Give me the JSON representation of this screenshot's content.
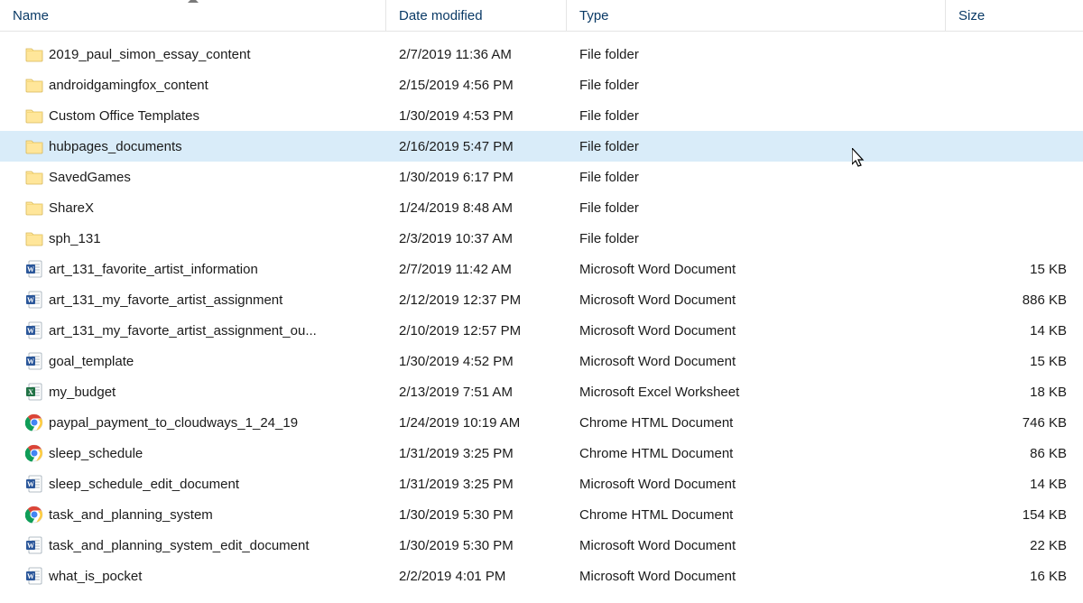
{
  "columns": {
    "name": "Name",
    "date": "Date modified",
    "type": "Type",
    "size": "Size"
  },
  "hover_index": 3,
  "items": [
    {
      "icon": "folder",
      "name": "2019_paul_simon_essay_content",
      "date": "2/7/2019 11:36 AM",
      "type": "File folder",
      "size": ""
    },
    {
      "icon": "folder",
      "name": "androidgamingfox_content",
      "date": "2/15/2019 4:56 PM",
      "type": "File folder",
      "size": ""
    },
    {
      "icon": "folder",
      "name": "Custom Office Templates",
      "date": "1/30/2019 4:53 PM",
      "type": "File folder",
      "size": ""
    },
    {
      "icon": "folder",
      "name": "hubpages_documents",
      "date": "2/16/2019 5:47 PM",
      "type": "File folder",
      "size": ""
    },
    {
      "icon": "folder",
      "name": "SavedGames",
      "date": "1/30/2019 6:17 PM",
      "type": "File folder",
      "size": ""
    },
    {
      "icon": "folder",
      "name": "ShareX",
      "date": "1/24/2019 8:48 AM",
      "type": "File folder",
      "size": ""
    },
    {
      "icon": "folder",
      "name": "sph_131",
      "date": "2/3/2019 10:37 AM",
      "type": "File folder",
      "size": ""
    },
    {
      "icon": "word",
      "name": "art_131_favorite_artist_information",
      "date": "2/7/2019 11:42 AM",
      "type": "Microsoft Word Document",
      "size": "15 KB"
    },
    {
      "icon": "word",
      "name": "art_131_my_favorte_artist_assignment",
      "date": "2/12/2019 12:37 PM",
      "type": "Microsoft Word Document",
      "size": "886 KB"
    },
    {
      "icon": "word",
      "name": "art_131_my_favorte_artist_assignment_ou...",
      "date": "2/10/2019 12:57 PM",
      "type": "Microsoft Word Document",
      "size": "14 KB"
    },
    {
      "icon": "word",
      "name": "goal_template",
      "date": "1/30/2019 4:52 PM",
      "type": "Microsoft Word Document",
      "size": "15 KB"
    },
    {
      "icon": "excel",
      "name": "my_budget",
      "date": "2/13/2019 7:51 AM",
      "type": "Microsoft Excel Worksheet",
      "size": "18 KB"
    },
    {
      "icon": "chrome",
      "name": "paypal_payment_to_cloudways_1_24_19",
      "date": "1/24/2019 10:19 AM",
      "type": "Chrome HTML Document",
      "size": "746 KB"
    },
    {
      "icon": "chrome",
      "name": "sleep_schedule",
      "date": "1/31/2019 3:25 PM",
      "type": "Chrome HTML Document",
      "size": "86 KB"
    },
    {
      "icon": "word",
      "name": "sleep_schedule_edit_document",
      "date": "1/31/2019 3:25 PM",
      "type": "Microsoft Word Document",
      "size": "14 KB"
    },
    {
      "icon": "chrome",
      "name": "task_and_planning_system",
      "date": "1/30/2019 5:30 PM",
      "type": "Chrome HTML Document",
      "size": "154 KB"
    },
    {
      "icon": "word",
      "name": "task_and_planning_system_edit_document",
      "date": "1/30/2019 5:30 PM",
      "type": "Microsoft Word Document",
      "size": "22 KB"
    },
    {
      "icon": "word",
      "name": "what_is_pocket",
      "date": "2/2/2019 4:01 PM",
      "type": "Microsoft Word Document",
      "size": "16 KB"
    }
  ]
}
